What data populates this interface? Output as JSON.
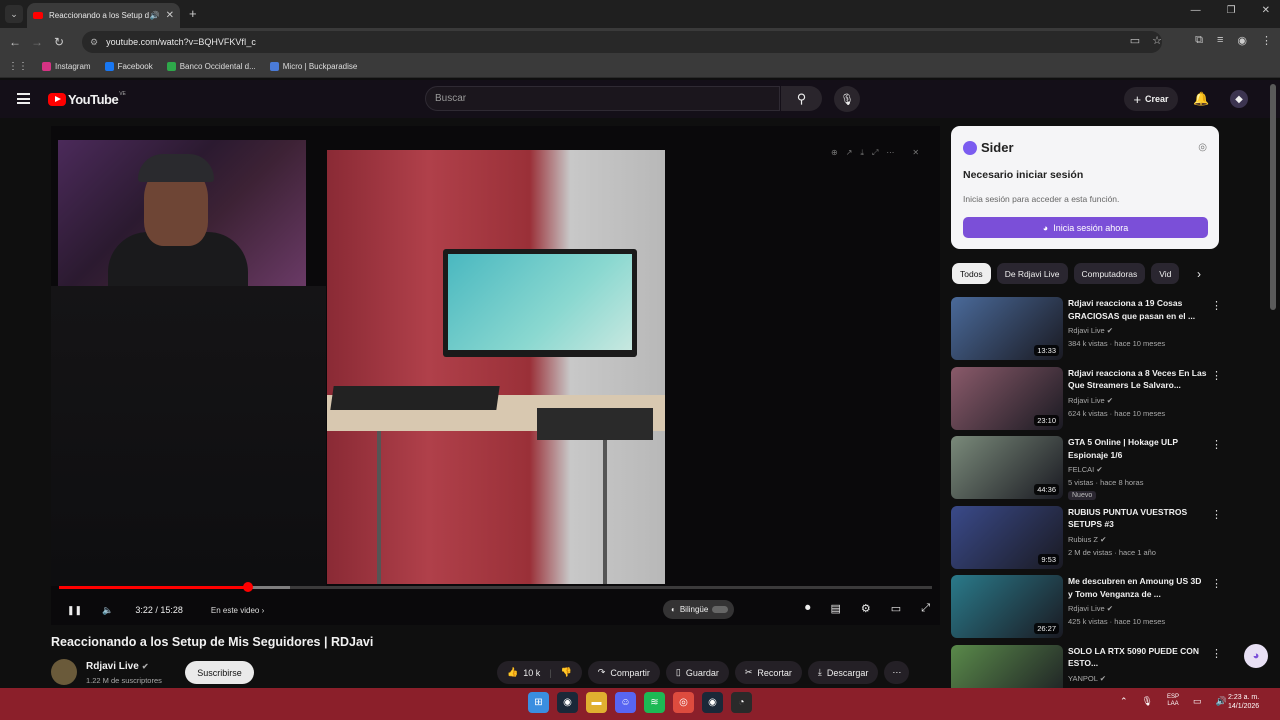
{
  "browser": {
    "tab_title": "Reaccionando a los Setup d",
    "url": "youtube.com/watch?v=BQHVFKVfI_c",
    "bookmarks": [
      {
        "label": "Instagram",
        "color": "#d63384"
      },
      {
        "label": "Facebook",
        "color": "#1877f2"
      },
      {
        "label": "Banco Occidental d...",
        "color": "#2ea84a"
      },
      {
        "label": "Micro | Buckparadise",
        "color": "#4a7bd8"
      }
    ]
  },
  "youtube": {
    "logo_text": "YouTube",
    "country": "VE",
    "search_placeholder": "Buscar",
    "create_label": "Crear"
  },
  "player": {
    "time": "3:22 / 15:28",
    "chapter": "En este video",
    "bilingual": "Bilingüe",
    "progress": 0.217,
    "buffered": 0.265
  },
  "video": {
    "title": "Reaccionando a los Setup de Mis Seguidores | RDJavi",
    "channel": "Rdjavi Live",
    "subscribers": "1.22 M de suscriptores",
    "subscribe_label": "Suscribirse",
    "likes": "10 k",
    "share_label": "Compartir",
    "save_label": "Guardar",
    "clip_label": "Recortar",
    "download_label": "Descargar"
  },
  "sider": {
    "brand": "Sider",
    "heading": "Necesario iniciar sesión",
    "description": "Inicia sesión para acceder a esta función.",
    "button": "Inicia sesión ahora"
  },
  "chips": [
    "Todos",
    "De Rdjavi Live",
    "Computadoras",
    "Vid"
  ],
  "recommendations": [
    {
      "title": "Rdjavi reacciona a 19 Cosas GRACIOSAS que pasan en el ...",
      "channel": "Rdjavi Live",
      "meta": "384 k vistas · hace 10 meses",
      "duration": "13:33",
      "thumb": "#4a6a9a"
    },
    {
      "title": "Rdjavi reacciona a  8 Veces En Las Que Streamers Le Salvaro...",
      "channel": "Rdjavi Live",
      "meta": "624 k vistas · hace 10 meses",
      "duration": "23:10",
      "thumb": "#8a5a6a"
    },
    {
      "title": "GTA 5 Online | Hokage ULP Espionaje 1/6",
      "channel": "FELCAI",
      "meta": "5 vistas · hace 8 horas",
      "duration": "44:36",
      "badge": "Nuevo",
      "thumb": "#7a8a7a"
    },
    {
      "title": "RUBIUS PUNTUA VUESTROS SETUPS #3",
      "channel": "Rubius Z",
      "meta": "2 M de vistas · hace 1 año",
      "duration": "9:53",
      "thumb": "#3a4a8a"
    },
    {
      "title": "Me descubren en Amoung US 3D y Tomo Venganza de ...",
      "channel": "Rdjavi Live",
      "meta": "425 k vistas · hace 10 meses",
      "duration": "26:27",
      "thumb": "#2a7a8a"
    },
    {
      "title": "SOLO LA RTX 5090 PUEDE CON ESTO...",
      "channel": "YANPOL",
      "meta": "",
      "duration": "",
      "thumb": "#5a8a4a"
    }
  ],
  "taskbar": {
    "lang": "ESP",
    "lang2": "LAA",
    "time": "2:23 a. m.",
    "date": "14/1/2026"
  }
}
